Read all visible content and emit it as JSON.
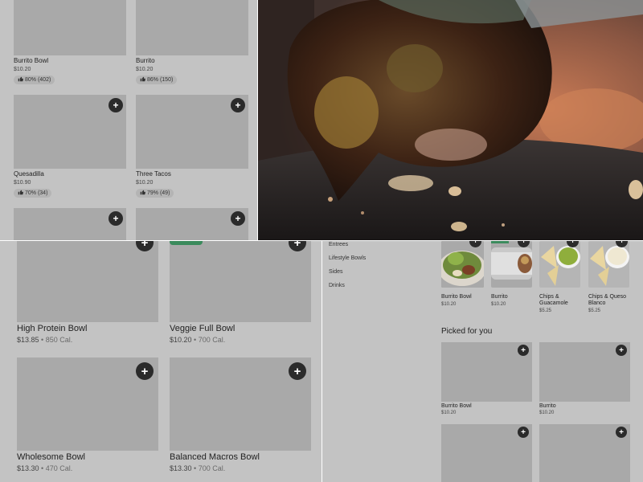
{
  "top_left": {
    "items": [
      {
        "name": "Burrito Bowl",
        "price": "$10.20",
        "rating": "80% (402)"
      },
      {
        "name": "Burrito",
        "price": "$10.20",
        "rating": "86% (150)"
      },
      {
        "name": "Quesadilla",
        "price": "$10.90",
        "rating": "70% (34)"
      },
      {
        "name": "Three Tacos",
        "price": "$10.20",
        "rating": "79% (49)"
      }
    ]
  },
  "bottom_left": {
    "items": [
      {
        "name": "High Protein Bowl",
        "price": "$13.85",
        "calories": "850 Cal."
      },
      {
        "name": "Veggie Full Bowl",
        "price": "$10.20",
        "calories": "700 Cal."
      },
      {
        "name": "Wholesome Bowl",
        "price": "$13.30",
        "calories": "470 Cal."
      },
      {
        "name": "Balanced Macros Bowl",
        "price": "$13.30",
        "calories": "700 Cal."
      }
    ],
    "separator": "•"
  },
  "bottom_right": {
    "categories": [
      "Entrees",
      "Lifestyle Bowls",
      "Sides",
      "Drinks"
    ],
    "featured": [
      {
        "name": "Burrito Bowl",
        "price": "$10.20"
      },
      {
        "name": "Burrito",
        "price": "$10.20"
      },
      {
        "name": "Chips & Guacamole",
        "price": "$5.25"
      },
      {
        "name": "Chips & Queso Blanco",
        "price": "$5.25"
      }
    ],
    "picked_heading": "Picked for you",
    "picked": [
      {
        "name": "Burrito Bowl",
        "price": "$10.20"
      },
      {
        "name": "Burrito",
        "price": "$10.20"
      }
    ]
  },
  "icons": {
    "add": "+",
    "thumb": "thumbs-up-icon"
  },
  "colors": {
    "panel_bg": "#c3c3c3",
    "placeholder": "#a9a9a9",
    "add_button": "#2b2b2b",
    "badge": "#3b8a5c"
  }
}
